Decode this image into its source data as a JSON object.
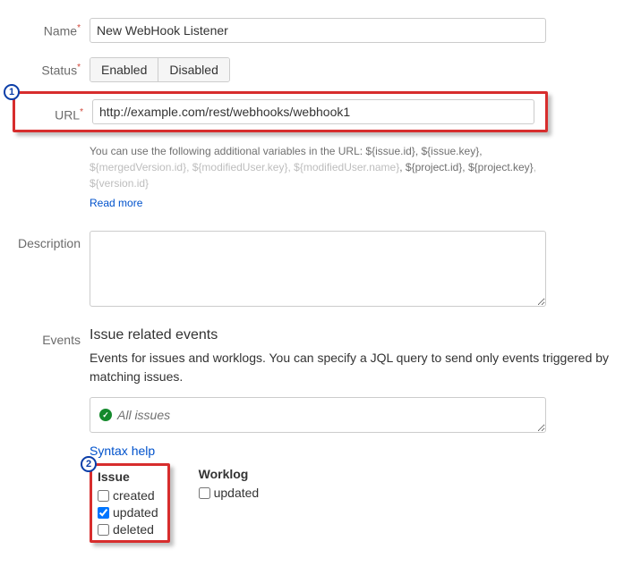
{
  "name": {
    "label": "Name",
    "value": "New WebHook Listener"
  },
  "status": {
    "label": "Status",
    "enabled": "Enabled",
    "disabled": "Disabled"
  },
  "url": {
    "label": "URL",
    "value": "http://example.com/rest/webhooks/webhook1",
    "help_pre": "You can use the following additional variables in the URL: ",
    "v1": "${issue.id}",
    "c1": ", ",
    "v2": "${issue.key}",
    "c2": ", ",
    "v3": "${mergedVersion.id}",
    "c3": ", ",
    "v4": "${modifiedUser.key}",
    "c4": ", ",
    "v5": "${modifiedUser.name}",
    "c5": ", ",
    "v6": "${project.id}",
    "c6": ", ",
    "v7": "${project.key}",
    "c7": ", ",
    "v8": "${version.id}",
    "read_more": "Read more"
  },
  "description": {
    "label": "Description",
    "value": ""
  },
  "events": {
    "label": "Events",
    "title": "Issue related events",
    "subtitle": "Events for issues and worklogs. You can specify a JQL query to send only events triggered by matching issues.",
    "jql_text": "All issues",
    "syntax_help": "Syntax help",
    "issue": {
      "title": "Issue",
      "created": "created",
      "updated": "updated",
      "deleted": "deleted"
    },
    "worklog": {
      "title": "Worklog",
      "updated": "updated"
    }
  },
  "badges": {
    "one": "1",
    "two": "2"
  }
}
